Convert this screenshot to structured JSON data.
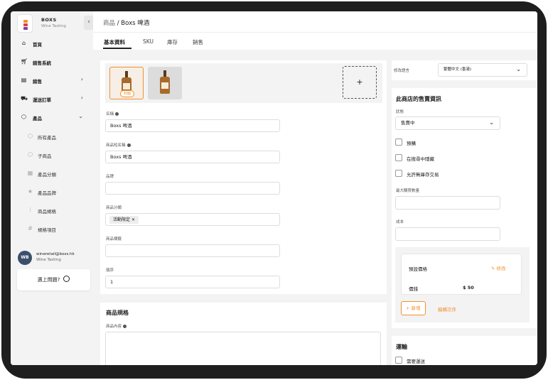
{
  "brand": {
    "name": "BOXS",
    "subtitle": "Wine Tasting",
    "colors": [
      "#f2902f",
      "#e0413a",
      "#7b3fb0"
    ]
  },
  "nav": [
    {
      "label": "首頁",
      "icon": "home-icon",
      "chevron": ""
    },
    {
      "label": "銷售系統",
      "icon": "cart-icon",
      "chevron": ""
    },
    {
      "label": "銷售",
      "icon": "document-icon",
      "chevron": "›"
    },
    {
      "label": "運送訂單",
      "icon": "truck-icon",
      "chevron": "›"
    },
    {
      "label": "產品",
      "icon": "box-icon",
      "chevron": "⌄"
    }
  ],
  "subnav": [
    {
      "label": "所有產品",
      "icon": "box-outline-icon"
    },
    {
      "label": "子商品",
      "icon": "box-outline-icon"
    },
    {
      "label": "產品分類",
      "icon": "grid-icon"
    },
    {
      "label": "產品品牌",
      "icon": "star-icon"
    },
    {
      "label": "商品規格",
      "icon": "tag-icon"
    },
    {
      "label": "規格項目",
      "icon": "hash-icon"
    }
  ],
  "user": {
    "initials": "WB",
    "email": "wineretail@boxs.hk",
    "org": "Wine Tasting"
  },
  "help": {
    "label": "遇上問題?"
  },
  "breadcrumb": {
    "parent": "商品",
    "separator": " / ",
    "current": "Boxs 啤酒"
  },
  "tabs": [
    "基本資料",
    "SKU",
    "庫存",
    "銷售"
  ],
  "basic": {
    "cover_label": "封面",
    "add_symbol": "+",
    "fields": {
      "name": {
        "label": "名稱",
        "value": "Boxs 啤酒"
      },
      "short_name": {
        "label": "商品短名稱",
        "value": "Boxs 啤酒"
      },
      "brand": {
        "label": "品牌",
        "value": ""
      },
      "category": {
        "label": "商品分類",
        "chip": "活動限定",
        "chip_close": "✕"
      },
      "tags": {
        "label": "商品標籤",
        "value": ""
      },
      "order": {
        "label": "順序",
        "value": "1"
      }
    }
  },
  "spec": {
    "title": "商品規格",
    "content_label": "商品內容"
  },
  "language": {
    "label": "修改語言",
    "value": "繁體中文 (香港)"
  },
  "sale": {
    "title": "此商店的售賣資訊",
    "status_label": "狀態",
    "status_value": "售賣中",
    "checkboxes": [
      "預購",
      "在搜尋中隱藏",
      "允許無庫存交易"
    ],
    "max_qty_label": "最大購買數量",
    "max_qty_value": "",
    "cost_label": "成本",
    "cost_value": "",
    "price_box": {
      "title": "預設價格",
      "edit": "修改",
      "price_label": "價錢",
      "price_value": "$ 50"
    },
    "add_button": "新增",
    "reorder": "編輯次序"
  },
  "shipping": {
    "title": "運輸",
    "checkbox": "需要運送"
  },
  "colors": {
    "accent": "#f2902f",
    "sidebar_bg": "#f3f3f4",
    "avatar_bg": "#3b4f6b"
  }
}
